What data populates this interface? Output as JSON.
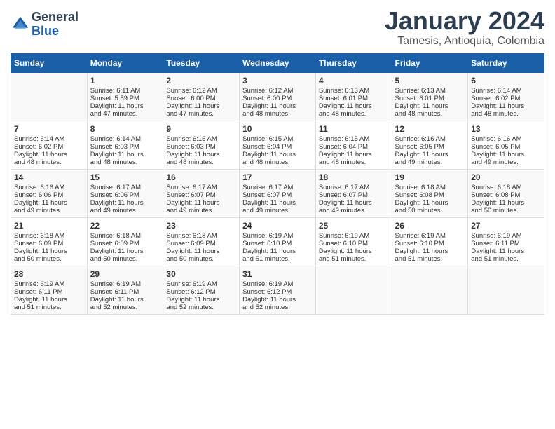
{
  "logo": {
    "line1": "General",
    "line2": "Blue"
  },
  "title": "January 2024",
  "subtitle": "Tamesis, Antioquia, Colombia",
  "headers": [
    "Sunday",
    "Monday",
    "Tuesday",
    "Wednesday",
    "Thursday",
    "Friday",
    "Saturday"
  ],
  "weeks": [
    [
      {
        "day": "",
        "content": ""
      },
      {
        "day": "1",
        "content": "Sunrise: 6:11 AM\nSunset: 5:59 PM\nDaylight: 11 hours\nand 47 minutes."
      },
      {
        "day": "2",
        "content": "Sunrise: 6:12 AM\nSunset: 6:00 PM\nDaylight: 11 hours\nand 47 minutes."
      },
      {
        "day": "3",
        "content": "Sunrise: 6:12 AM\nSunset: 6:00 PM\nDaylight: 11 hours\nand 48 minutes."
      },
      {
        "day": "4",
        "content": "Sunrise: 6:13 AM\nSunset: 6:01 PM\nDaylight: 11 hours\nand 48 minutes."
      },
      {
        "day": "5",
        "content": "Sunrise: 6:13 AM\nSunset: 6:01 PM\nDaylight: 11 hours\nand 48 minutes."
      },
      {
        "day": "6",
        "content": "Sunrise: 6:14 AM\nSunset: 6:02 PM\nDaylight: 11 hours\nand 48 minutes."
      }
    ],
    [
      {
        "day": "7",
        "content": "Sunrise: 6:14 AM\nSunset: 6:02 PM\nDaylight: 11 hours\nand 48 minutes."
      },
      {
        "day": "8",
        "content": "Sunrise: 6:14 AM\nSunset: 6:03 PM\nDaylight: 11 hours\nand 48 minutes."
      },
      {
        "day": "9",
        "content": "Sunrise: 6:15 AM\nSunset: 6:03 PM\nDaylight: 11 hours\nand 48 minutes."
      },
      {
        "day": "10",
        "content": "Sunrise: 6:15 AM\nSunset: 6:04 PM\nDaylight: 11 hours\nand 48 minutes."
      },
      {
        "day": "11",
        "content": "Sunrise: 6:15 AM\nSunset: 6:04 PM\nDaylight: 11 hours\nand 48 minutes."
      },
      {
        "day": "12",
        "content": "Sunrise: 6:16 AM\nSunset: 6:05 PM\nDaylight: 11 hours\nand 49 minutes."
      },
      {
        "day": "13",
        "content": "Sunrise: 6:16 AM\nSunset: 6:05 PM\nDaylight: 11 hours\nand 49 minutes."
      }
    ],
    [
      {
        "day": "14",
        "content": "Sunrise: 6:16 AM\nSunset: 6:06 PM\nDaylight: 11 hours\nand 49 minutes."
      },
      {
        "day": "15",
        "content": "Sunrise: 6:17 AM\nSunset: 6:06 PM\nDaylight: 11 hours\nand 49 minutes."
      },
      {
        "day": "16",
        "content": "Sunrise: 6:17 AM\nSunset: 6:07 PM\nDaylight: 11 hours\nand 49 minutes."
      },
      {
        "day": "17",
        "content": "Sunrise: 6:17 AM\nSunset: 6:07 PM\nDaylight: 11 hours\nand 49 minutes."
      },
      {
        "day": "18",
        "content": "Sunrise: 6:17 AM\nSunset: 6:07 PM\nDaylight: 11 hours\nand 49 minutes."
      },
      {
        "day": "19",
        "content": "Sunrise: 6:18 AM\nSunset: 6:08 PM\nDaylight: 11 hours\nand 50 minutes."
      },
      {
        "day": "20",
        "content": "Sunrise: 6:18 AM\nSunset: 6:08 PM\nDaylight: 11 hours\nand 50 minutes."
      }
    ],
    [
      {
        "day": "21",
        "content": "Sunrise: 6:18 AM\nSunset: 6:09 PM\nDaylight: 11 hours\nand 50 minutes."
      },
      {
        "day": "22",
        "content": "Sunrise: 6:18 AM\nSunset: 6:09 PM\nDaylight: 11 hours\nand 50 minutes."
      },
      {
        "day": "23",
        "content": "Sunrise: 6:18 AM\nSunset: 6:09 PM\nDaylight: 11 hours\nand 50 minutes."
      },
      {
        "day": "24",
        "content": "Sunrise: 6:19 AM\nSunset: 6:10 PM\nDaylight: 11 hours\nand 51 minutes."
      },
      {
        "day": "25",
        "content": "Sunrise: 6:19 AM\nSunset: 6:10 PM\nDaylight: 11 hours\nand 51 minutes."
      },
      {
        "day": "26",
        "content": "Sunrise: 6:19 AM\nSunset: 6:10 PM\nDaylight: 11 hours\nand 51 minutes."
      },
      {
        "day": "27",
        "content": "Sunrise: 6:19 AM\nSunset: 6:11 PM\nDaylight: 11 hours\nand 51 minutes."
      }
    ],
    [
      {
        "day": "28",
        "content": "Sunrise: 6:19 AM\nSunset: 6:11 PM\nDaylight: 11 hours\nand 51 minutes."
      },
      {
        "day": "29",
        "content": "Sunrise: 6:19 AM\nSunset: 6:11 PM\nDaylight: 11 hours\nand 52 minutes."
      },
      {
        "day": "30",
        "content": "Sunrise: 6:19 AM\nSunset: 6:12 PM\nDaylight: 11 hours\nand 52 minutes."
      },
      {
        "day": "31",
        "content": "Sunrise: 6:19 AM\nSunset: 6:12 PM\nDaylight: 11 hours\nand 52 minutes."
      },
      {
        "day": "",
        "content": ""
      },
      {
        "day": "",
        "content": ""
      },
      {
        "day": "",
        "content": ""
      }
    ]
  ]
}
